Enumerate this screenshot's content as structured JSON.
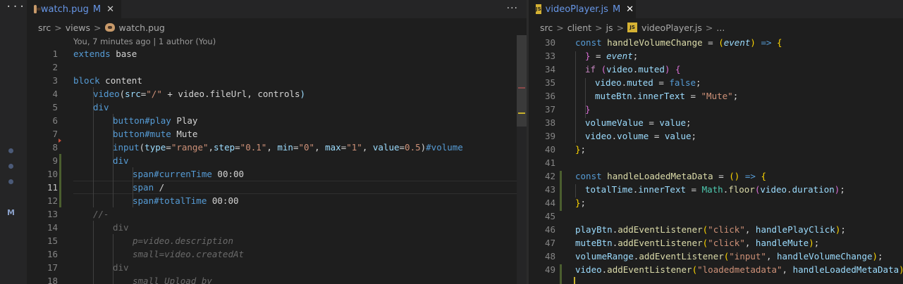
{
  "left_editor": {
    "tab": {
      "filename": "watch.pug",
      "modified": "M",
      "close": "✕"
    },
    "more": "···",
    "breadcrumb": [
      "src",
      "views",
      "watch.pug"
    ],
    "codelens": "You, 7 minutes ago | 1 author (You)",
    "current_line": 11,
    "lines": [
      {
        "n": "1"
      },
      {
        "n": "2"
      },
      {
        "n": "3"
      },
      {
        "n": "4"
      },
      {
        "n": "5"
      },
      {
        "n": "6"
      },
      {
        "n": "7"
      },
      {
        "n": "8"
      },
      {
        "n": "9"
      },
      {
        "n": "10"
      },
      {
        "n": "11"
      },
      {
        "n": "12"
      },
      {
        "n": "13"
      },
      {
        "n": "14"
      },
      {
        "n": "15"
      },
      {
        "n": "16"
      },
      {
        "n": "17"
      },
      {
        "n": "18"
      }
    ]
  },
  "right_editor": {
    "tab": {
      "filename": "videoPlayer.js",
      "modified": "M",
      "close": "✕"
    },
    "breadcrumb": [
      "src",
      "client",
      "js",
      "videoPlayer.js",
      "..."
    ],
    "lines": [
      {
        "n": "30"
      },
      {
        "n": "33"
      },
      {
        "n": "34"
      },
      {
        "n": "35"
      },
      {
        "n": "36"
      },
      {
        "n": "37"
      },
      {
        "n": "38"
      },
      {
        "n": "39"
      },
      {
        "n": "40"
      },
      {
        "n": "41"
      },
      {
        "n": "42"
      },
      {
        "n": "43"
      },
      {
        "n": "44"
      },
      {
        "n": "45"
      },
      {
        "n": "46"
      },
      {
        "n": "47"
      },
      {
        "n": "48"
      },
      {
        "n": "49"
      }
    ]
  },
  "activity_bar": {
    "more": "···",
    "badge": "M"
  },
  "code_text": {
    "l1": [
      "extends",
      " base"
    ],
    "l3": [
      "block",
      " content"
    ],
    "l4": [
      "video",
      "(",
      "src",
      "=",
      "\"/\"",
      " + video.fileUrl, ",
      "controls",
      ")"
    ],
    "l5": [
      "div"
    ],
    "l6": [
      "button#play",
      " Play"
    ],
    "l7": [
      "button#mute",
      " Mute"
    ],
    "l8": [
      "input",
      "(",
      "type",
      "=",
      "\"range\"",
      ",",
      "step",
      "=",
      "\"0.1\"",
      ", ",
      "min",
      "=",
      "\"0\"",
      ", ",
      "max",
      "=",
      "\"1\"",
      ", ",
      "value",
      "=",
      "0.5",
      ")",
      "#volume"
    ],
    "l9": [
      "div"
    ],
    "l10": [
      "span#currenTime",
      " 00:00"
    ],
    "l11": [
      "span",
      " /"
    ],
    "l12": [
      "span#totalTime",
      " 00:00"
    ],
    "l13": [
      "//-"
    ],
    "l14": [
      "div"
    ],
    "l15": [
      "p=video.description"
    ],
    "l16": [
      "small=video.createdAt"
    ],
    "l17": [
      "div"
    ],
    "l18": [
      "small Upload by"
    ],
    "r30": [
      "const",
      " ",
      "handleVolumeChange",
      " = ",
      "(",
      "event",
      ")",
      " => ",
      "{"
    ],
    "r33": [
      "}",
      " = ",
      "event",
      ";"
    ],
    "r34": [
      "if",
      " ",
      "(",
      "video",
      ".",
      "muted",
      ")",
      " ",
      "{"
    ],
    "r35": [
      "video",
      ".",
      "muted",
      " = ",
      "false",
      ";"
    ],
    "r36": [
      "muteBtn",
      ".",
      "innerText",
      " = ",
      "\"Mute\"",
      ";"
    ],
    "r37": [
      "}"
    ],
    "r38": [
      "volumeValue",
      " = ",
      "value",
      ";"
    ],
    "r39": [
      "video",
      ".",
      "volume",
      " = ",
      "value",
      ";"
    ],
    "r40": [
      "}",
      ";"
    ],
    "r42": [
      "const",
      " ",
      "handleLoadedMetaData",
      " = ",
      "()",
      " => ",
      "{"
    ],
    "r43": [
      "totalTime",
      ".",
      "innerText",
      " = ",
      "Math",
      ".",
      "floor",
      "(",
      "video",
      ".",
      "duration",
      ")",
      ";"
    ],
    "r44": [
      "}",
      ";"
    ],
    "r46": [
      "playBtn",
      ".",
      "addEventListener",
      "(",
      "\"click\"",
      ", ",
      "handlePlayClick",
      ")",
      ";"
    ],
    "r47": [
      "muteBtn",
      ".",
      "addEventListener",
      "(",
      "\"click\"",
      ", ",
      "handleMute",
      ")",
      ";"
    ],
    "r48": [
      "volumeRange",
      ".",
      "addEventListener",
      "(",
      "\"input\"",
      ", ",
      "handleVolumeChange",
      ")",
      ";"
    ],
    "r49": [
      "video",
      ".",
      "addEventListener",
      "(",
      "\"loadedmetadata\"",
      ", ",
      "handleLoadedMetaData",
      ")",
      ";"
    ]
  }
}
